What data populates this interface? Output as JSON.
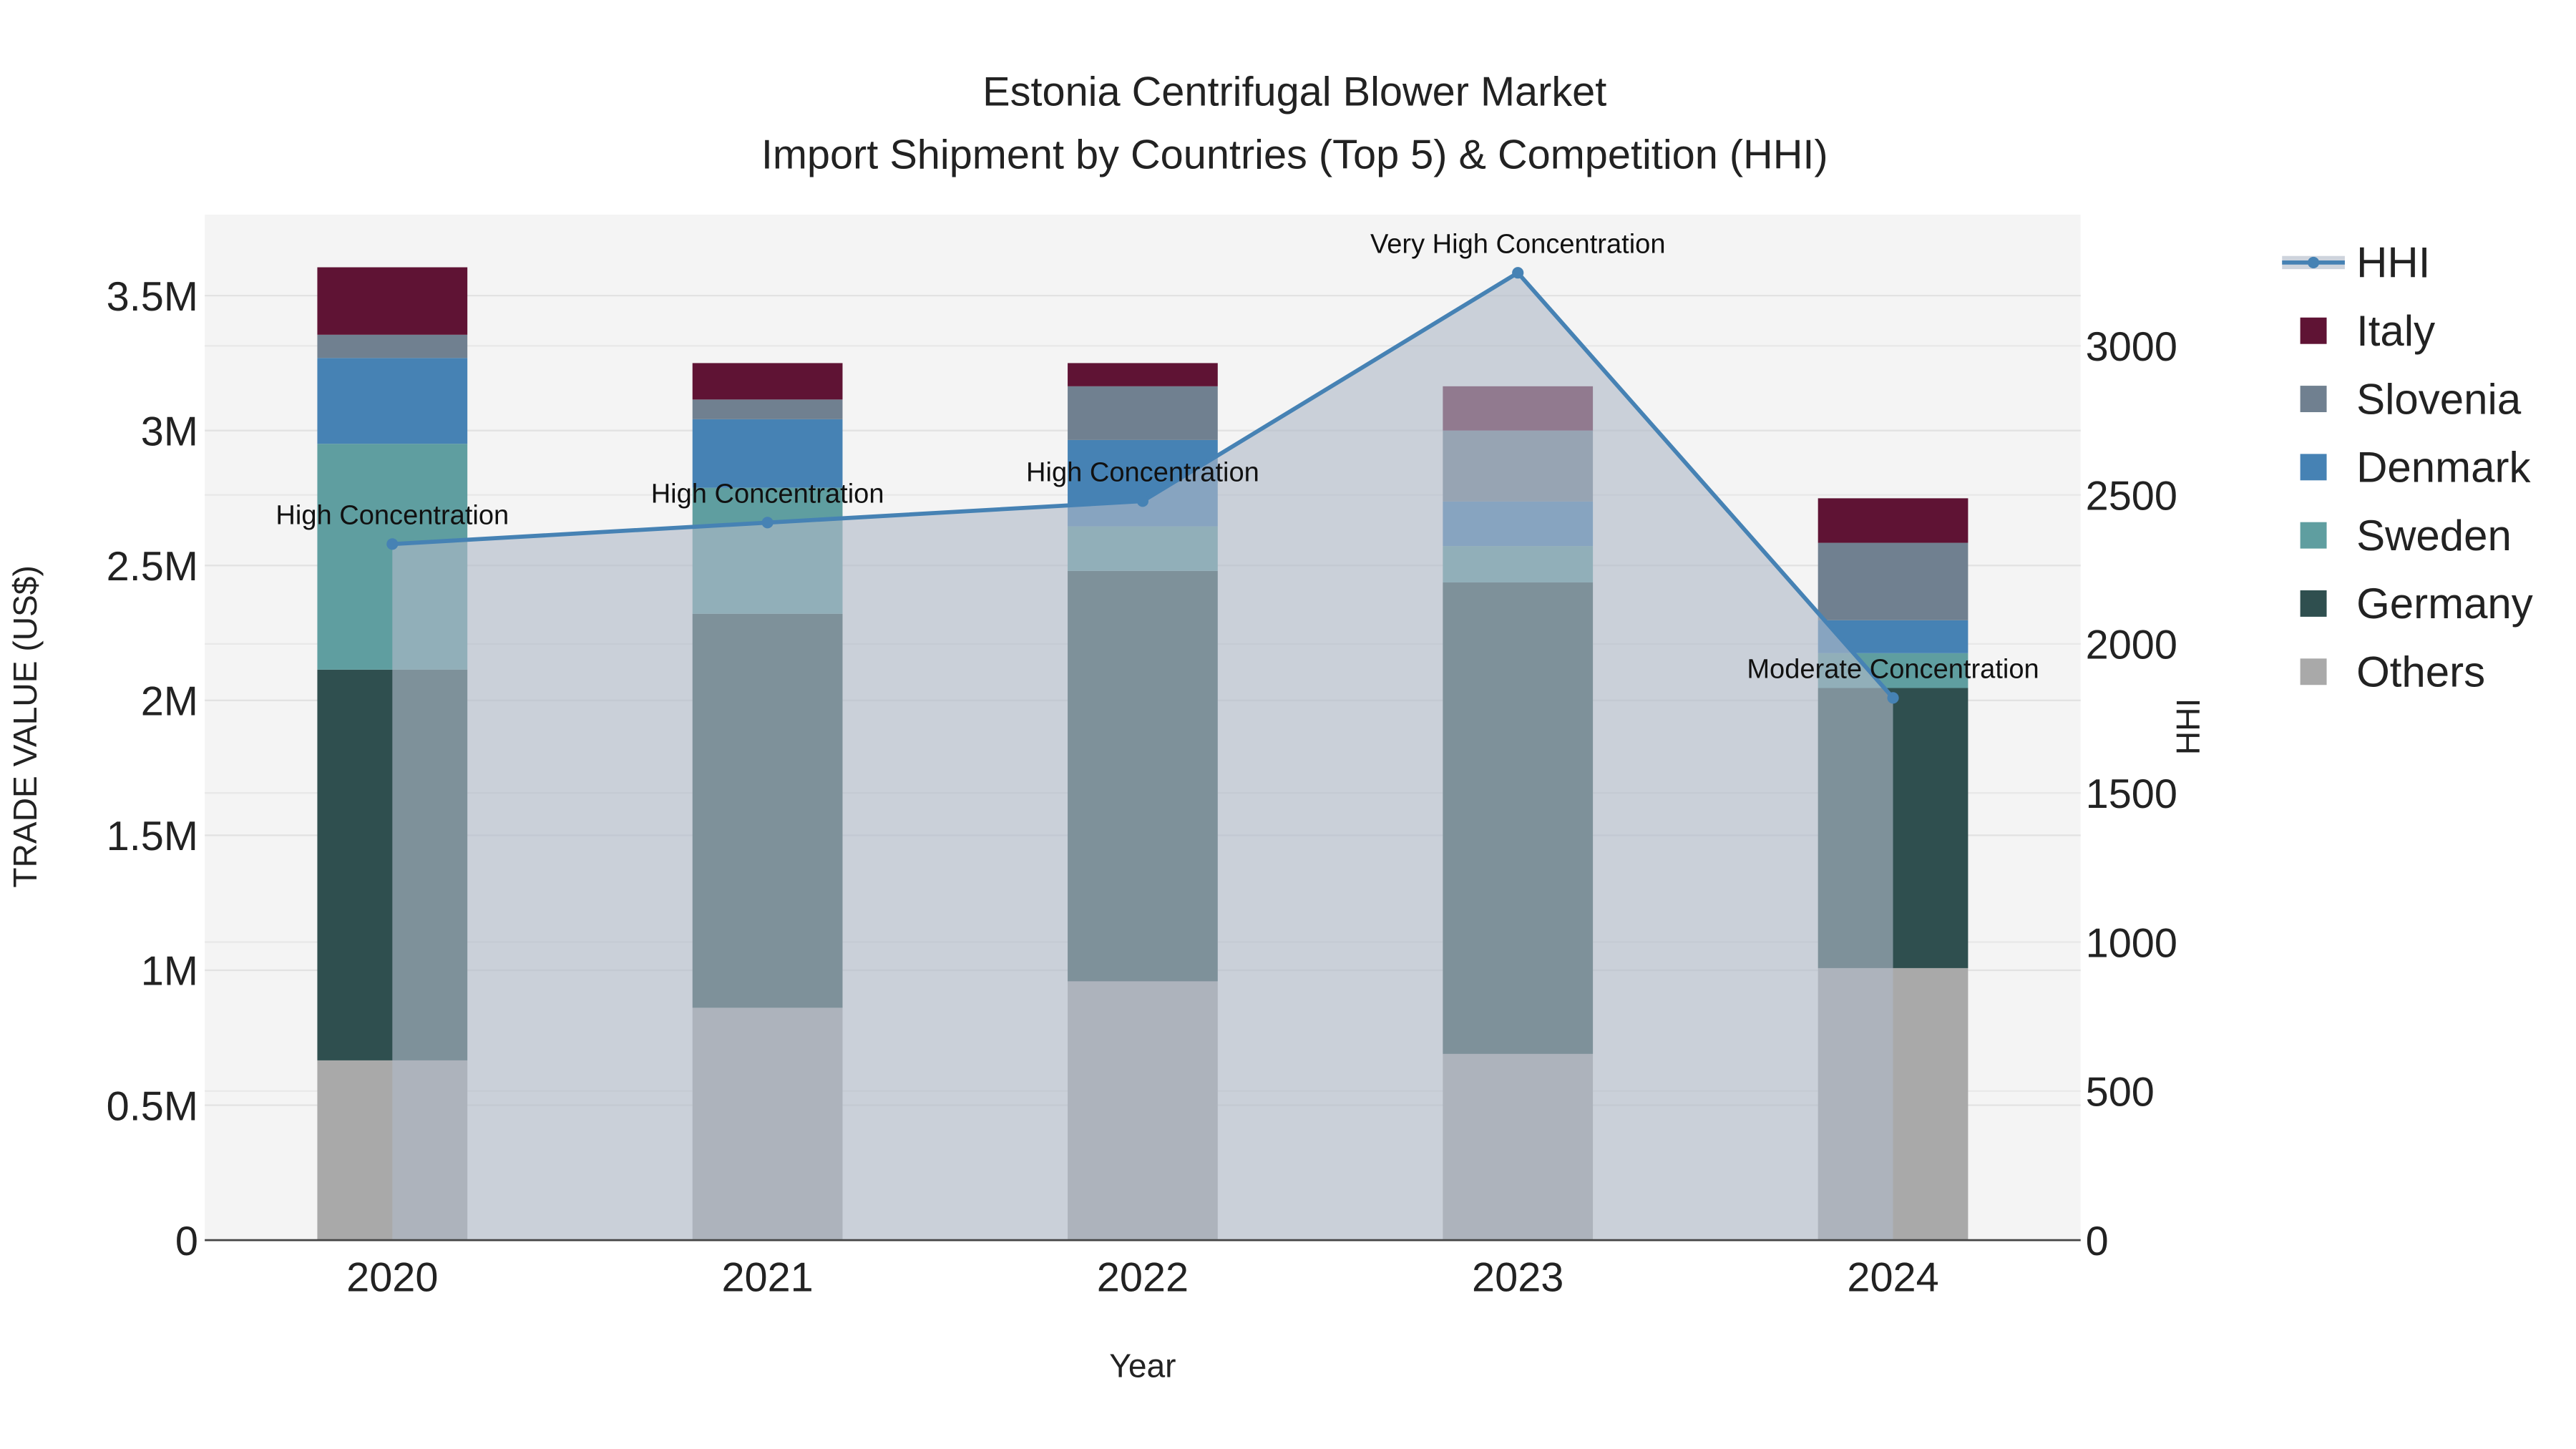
{
  "chart_data": {
    "type": "bar",
    "stacked": true,
    "title": "Estonia Centrifugal Blower Market",
    "subtitle": "Import Shipment by Countries (Top 5) & Competition (HHI)",
    "xlabel": "Year",
    "ylabel": "TRADE VALUE (US$)",
    "y2label": "HHI",
    "categories": [
      "2020",
      "2021",
      "2022",
      "2023",
      "2024"
    ],
    "ylim": [
      0,
      3800000
    ],
    "y2lim": [
      0,
      3440
    ],
    "yticks": [
      0,
      500000,
      1000000,
      1500000,
      2000000,
      2500000,
      3000000,
      3500000
    ],
    "ytick_labels": [
      "0",
      "0.5M",
      "1M",
      "1.5M",
      "2M",
      "2.5M",
      "3M",
      "3.5M"
    ],
    "y2ticks": [
      0,
      500,
      1000,
      1500,
      2000,
      2500,
      3000
    ],
    "y2tick_labels": [
      "0",
      "500",
      "1000",
      "1500",
      "2000",
      "2500",
      "3000"
    ],
    "grid": true,
    "legend_position": "right",
    "series": [
      {
        "name": "Others",
        "color": "#a9a9a9",
        "values": [
          666000,
          861000,
          959000,
          690000,
          1008000
        ]
      },
      {
        "name": "Germany",
        "color": "#2f4f4f",
        "values": [
          1448000,
          1460000,
          1521000,
          1747000,
          1038000
        ]
      },
      {
        "name": "Sweden",
        "color": "#5f9ea0",
        "values": [
          837000,
          467000,
          165000,
          135000,
          129000
        ]
      },
      {
        "name": "Denmark",
        "color": "#4682b4",
        "values": [
          318000,
          254000,
          320000,
          165000,
          122000
        ]
      },
      {
        "name": "Slovenia",
        "color": "#708090",
        "values": [
          86000,
          73000,
          199000,
          263000,
          287000
        ]
      },
      {
        "name": "Italy",
        "color": "#5f1334",
        "values": [
          250000,
          135000,
          86000,
          164000,
          165000
        ]
      }
    ],
    "hhi": {
      "name": "HHI",
      "color": "#4682b4",
      "values": [
        2335,
        2407,
        2479,
        3245,
        1819
      ],
      "annotations": [
        "High Concentration",
        "High Concentration",
        "High Concentration",
        "Very High Concentration",
        "Moderate Concentration"
      ]
    },
    "legend_order": [
      "HHI",
      "Italy",
      "Slovenia",
      "Denmark",
      "Sweden",
      "Germany",
      "Others"
    ]
  }
}
